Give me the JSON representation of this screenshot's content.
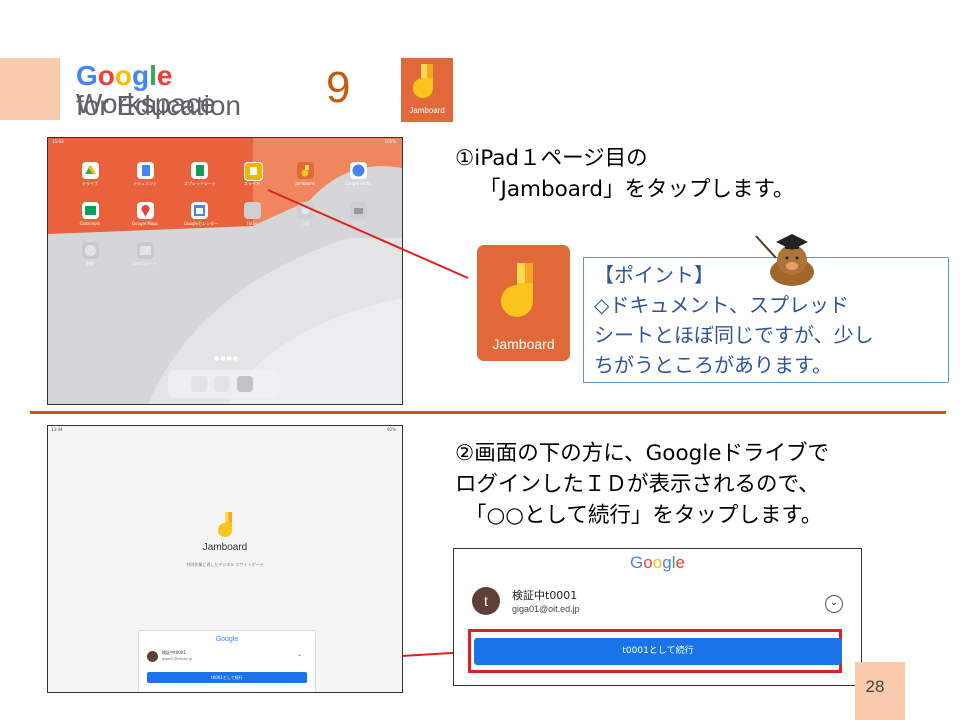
{
  "header": {
    "logo_google": "Google",
    "logo_workspace": "Workspace",
    "logo_for_education": "for Education",
    "step_number": "9",
    "app_icon_label": "Jamboard"
  },
  "step1": {
    "line1": "①iPad１ページ目の",
    "line2": "「Jamboard」をタップします。",
    "large_icon_label": "Jamboard"
  },
  "point_box": {
    "title": "【ポイント】",
    "line1": "◇ドキュメント、スプレッド",
    "line2": "シートとほぼ同じですが、少し",
    "line3": "ちがうところがあります。"
  },
  "ipad_home": {
    "status_time": "15:03",
    "status_battery": "100%",
    "apps": [
      "ドライブ",
      "ドキュメント",
      "スプレッドシート",
      "スライド",
      "Jamboard",
      "Google Earth",
      "Classroom",
      "Google Maps",
      "Googleカレンダー",
      "Fotos",
      "写真",
      "カメラ",
      "時計",
      "ロイロノート"
    ]
  },
  "step2": {
    "line1": "②画面の下の方に、Googleドライブで",
    "line2": "ログインしたＩＤが表示されるので、",
    "line3": "「○○として続行」をタップします。"
  },
  "jamboard_screen": {
    "status_time": "13:44",
    "status_battery": "92%",
    "title": "Jamboard",
    "subtitle": "共同作業に適したデジタル ホワイトボード",
    "google_logo": "Google",
    "account_name": "検証中t0001",
    "account_email": "giga01@oit.ed.jp",
    "continue_button": "t0001として続行"
  },
  "zoom_panel": {
    "google_logo": "Google",
    "avatar_letter": "t",
    "account_name": "検証中t0001",
    "account_email": "giga01@oit.ed.jp",
    "continue_button": "t0001として続行"
  },
  "page_number": "28",
  "colors": {
    "accent_peach": "#f8cbad",
    "divider_brown": "#c55a11",
    "step_number_orange": "#c55a11",
    "jamboard_orange": "#e16939",
    "highlight_red": "#e02020",
    "button_blue": "#1a73e8",
    "point_text_blue": "#2f5597"
  }
}
